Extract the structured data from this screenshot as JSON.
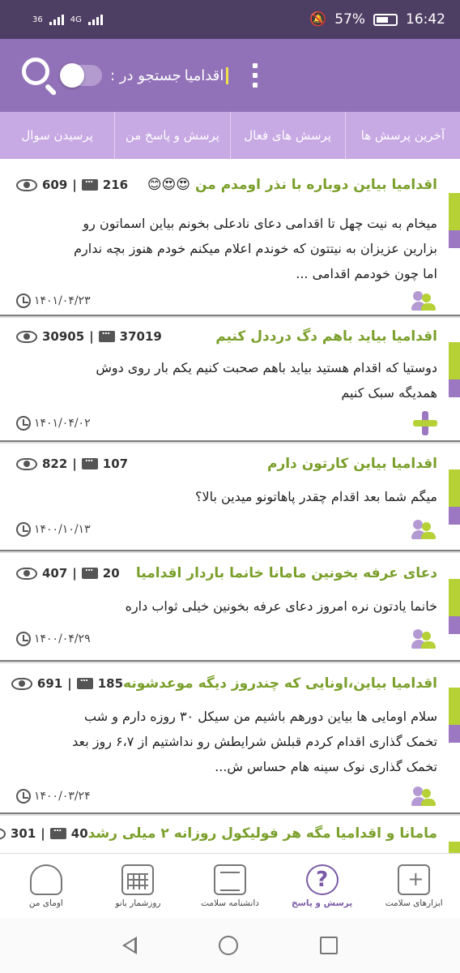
{
  "status_bar": {
    "network_left": "36",
    "network_right": "4G",
    "battery": "57%",
    "time": "16:42"
  },
  "header": {
    "search_label": "جستجو در :",
    "search_value": "اقدامیا"
  },
  "tabs": [
    {
      "label": "آخرین پرسش ها"
    },
    {
      "label": "پرسش های فعال"
    },
    {
      "label": "پرسش و پاسخ من"
    },
    {
      "label": "پرسیدن سوال"
    }
  ],
  "questions": [
    {
      "title": "اقدامیا بیاین دوباره با نذر اومدم من",
      "emojis": "😍😍😊",
      "comments": "216",
      "views": "609",
      "body_lines": [
        "میخام به نیت چهل تا اقدامی دعای نادعلی بخونم  بیاین اسماتون رو",
        "بزارین عزیزان به نیتتون که خوندم اعلام میکنم  خودم هنوز بچه ندارم",
        "اما چون خودمم اقدامی ..."
      ],
      "date": "۱۴۰۱/۰۴/۲۳",
      "avatar_icon": "users-icon"
    },
    {
      "title": "اقدامیا بیاید باهم دگ درددل کنیم",
      "emojis": "",
      "comments": "37019",
      "views": "30905",
      "body_lines": [
        "دوستیا که اقدام هستید بیاید باهم صحبت کنیم یکم بار روی دوش",
        "همدیگه سبک کنیم"
      ],
      "date": "۱۴۰۱/۰۴/۰۲",
      "avatar_icon": "plus-icon"
    },
    {
      "title": "اقدامیا بیاین کارتون دارم",
      "emojis": "",
      "comments": "107",
      "views": "822",
      "body_lines": [
        "میگم شما بعد اقدام چقدر پاهاتونو میدین بالا؟"
      ],
      "date": "۱۴۰۰/۱۰/۱۳",
      "avatar_icon": "users-icon"
    },
    {
      "title": "دعای عرفه بخونین مامانا خانما باردار اقدامیا",
      "emojis": "",
      "comments": "20",
      "views": "407",
      "body_lines": [
        "خانما یادتون نره امروز دعای عرفه بخونین خیلی ثواب داره"
      ],
      "date": "۱۴۰۰/۰۴/۲۹",
      "avatar_icon": "users-icon"
    },
    {
      "title": "اقدامیا بیاین،اونایی که چندروز دیگه موعدشونه",
      "emojis": "",
      "comments": "185",
      "views": "691",
      "body_lines": [
        "سلام اومایی ها بیاین دورهم باشیم  من سیکل ۳۰ روزه دارم و شب",
        "تخمک گذاری اقدام کردم قبلش شرایطش رو نداشتیم از ۶،۷ روز بعد",
        "تخمک گذاری نوک سینه هام حساس ش..."
      ],
      "date": "۱۴۰۰/۰۳/۲۴",
      "avatar_icon": "users-icon"
    },
    {
      "title": "مامانا و اقدامیا مگه هر فولیکول روزانه ۲ میلی رشد",
      "emojis": "",
      "comments": "40",
      "views": "301",
      "body_lines": [],
      "date": "",
      "avatar_icon": ""
    }
  ],
  "bottom_nav": [
    {
      "label": "ابزارهای سلامت",
      "icon": "health-kit-icon"
    },
    {
      "label": "پرسش و پاسخ",
      "icon": "question-icon",
      "active": true
    },
    {
      "label": "دانشنامه سلامت",
      "icon": "encyclopedia-icon"
    },
    {
      "label": "روزشمار بانو",
      "icon": "calendar-icon"
    },
    {
      "label": "اومای من",
      "icon": "profile-icon"
    }
  ],
  "colors": {
    "status_bar": "#4d3e63",
    "header": "#9171b7",
    "tabs": "#c7a9e4",
    "title_green": "#7a9f2a",
    "stripe_green": "#b5d136",
    "stripe_purple": "#9d78c2",
    "active_nav": "#7a5aa6"
  }
}
